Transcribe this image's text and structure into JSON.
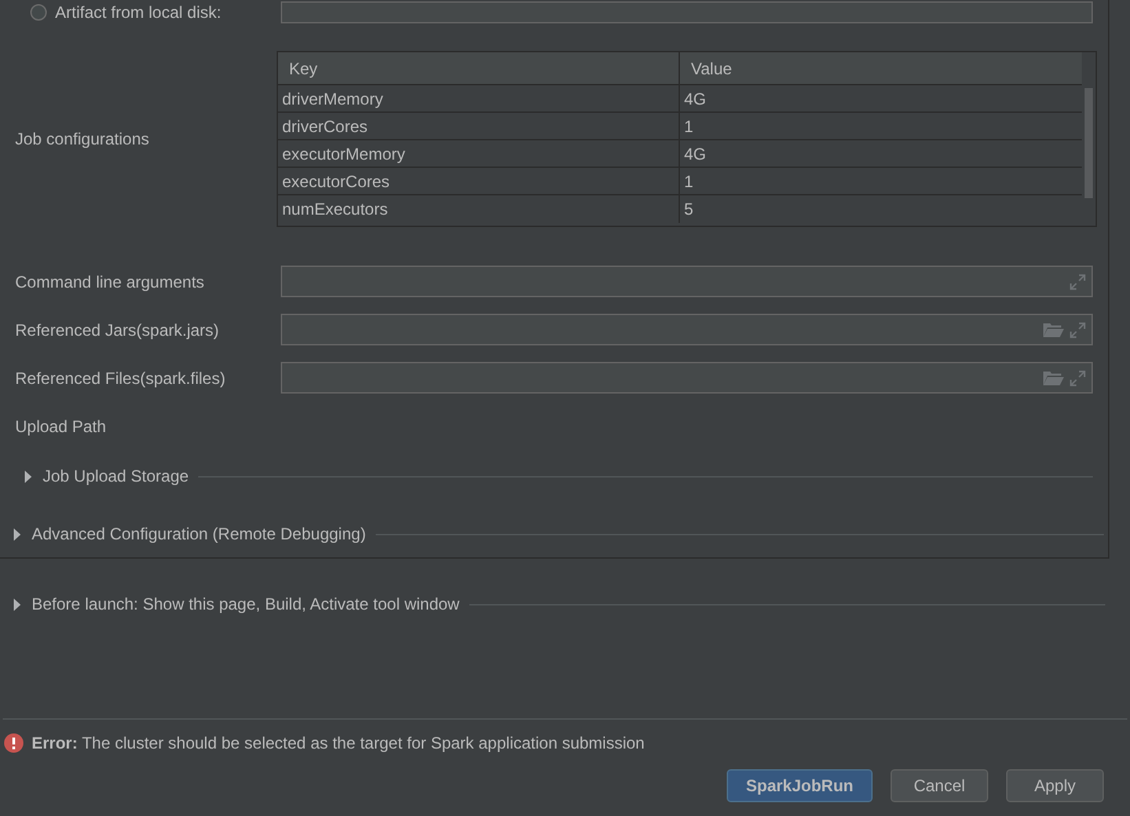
{
  "artifact_option": {
    "label": "Artifact from local disk:",
    "selected": false
  },
  "job_configurations": {
    "label": "Job configurations",
    "columns": [
      "Key",
      "Value"
    ],
    "rows": [
      {
        "key": "driverMemory",
        "value": "4G"
      },
      {
        "key": "driverCores",
        "value": "1"
      },
      {
        "key": "executorMemory",
        "value": "4G"
      },
      {
        "key": "executorCores",
        "value": "1"
      },
      {
        "key": "numExecutors",
        "value": "5"
      }
    ]
  },
  "fields": [
    {
      "label": "Command line arguments",
      "kind": "expand"
    },
    {
      "label": "Referenced Jars(spark.jars)",
      "kind": "browse"
    },
    {
      "label": "Referenced Files(spark.files)",
      "kind": "browse"
    }
  ],
  "upload_path": {
    "label": "Upload Path",
    "section": {
      "label": "Job Upload Storage",
      "expanded": false
    }
  },
  "advanced": {
    "label": "Advanced Configuration (Remote Debugging)",
    "expanded": false
  },
  "before_launch": {
    "label": "Before launch: Show this page, Build, Activate tool window",
    "expanded": false
  },
  "error": {
    "title": "Error:",
    "message": "The cluster should be selected as the target for Spark application submission"
  },
  "buttons": [
    {
      "label": "SparkJobRun",
      "kind": "primary"
    },
    {
      "label": "Cancel",
      "kind": "default"
    },
    {
      "label": "Apply",
      "kind": "default"
    }
  ]
}
